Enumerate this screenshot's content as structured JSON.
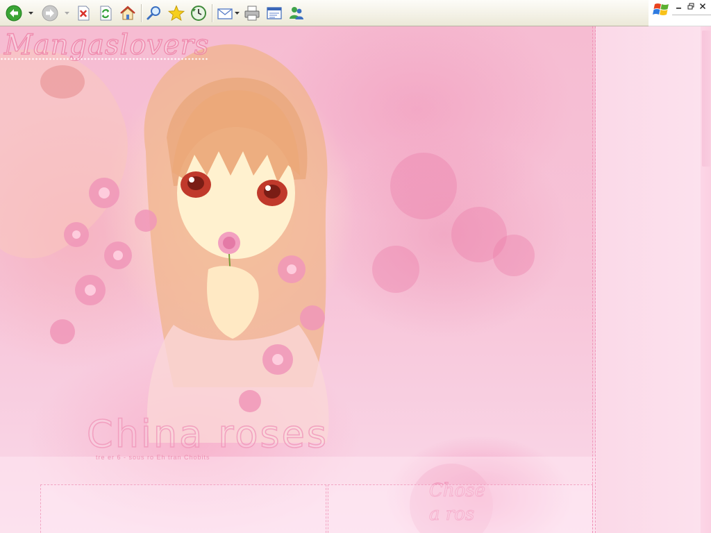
{
  "toolbar": {
    "buttons": [
      {
        "name": "back",
        "icon": "back-arrow-icon",
        "color": "#3aa535"
      },
      {
        "name": "forward",
        "icon": "forward-arrow-icon",
        "color": "#b7b7b7"
      },
      {
        "name": "stop",
        "icon": "stop-icon",
        "color": "#d9302a"
      },
      {
        "name": "refresh",
        "icon": "refresh-icon",
        "color": "#33a03a"
      },
      {
        "name": "home",
        "icon": "home-icon",
        "color": "#e8a13a"
      },
      {
        "name": "search",
        "icon": "search-icon",
        "color": "#3b6fc0"
      },
      {
        "name": "favorites",
        "icon": "star-icon",
        "color": "#f2c318"
      },
      {
        "name": "history",
        "icon": "history-icon",
        "color": "#3f8a3a"
      },
      {
        "name": "mail",
        "icon": "mail-icon",
        "color": "#5b7fc8"
      },
      {
        "name": "print",
        "icon": "printer-icon",
        "color": "#7a7a7a"
      },
      {
        "name": "edit",
        "icon": "edit-page-icon",
        "color": "#3a66b8"
      },
      {
        "name": "messenger",
        "icon": "messenger-icon",
        "color": "#3fa34a"
      }
    ]
  },
  "page": {
    "brand": "Mangaslovers",
    "banner_title": "China roses",
    "credit": "tre er 6 - sous ro Eh tran Chobits",
    "choose_lines": [
      "Chose",
      "a ros"
    ],
    "accent_pink": "#f08cb4",
    "background_pink": "#fbe0ee"
  }
}
